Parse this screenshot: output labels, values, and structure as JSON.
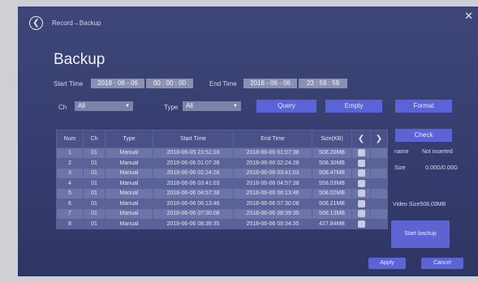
{
  "breadcrumb": "Record→Backup",
  "title": "Backup",
  "start_time": {
    "label": "Start Time",
    "date": "2018 - 06 - 06",
    "time": "00 : 00 : 00"
  },
  "end_time": {
    "label": "End Time",
    "date": "2018 - 06 - 06",
    "time": "23 : 59 : 59"
  },
  "ch": {
    "label": "Ch",
    "value": "All"
  },
  "type": {
    "label": "Type",
    "value": "All"
  },
  "buttons": {
    "query": "Query",
    "empty": "Empty",
    "format": "Format",
    "check": "Check",
    "start_backup": "Start backup",
    "apply": "Apply",
    "cancel": "Cancel"
  },
  "table": {
    "headers": [
      "Num",
      "Ch",
      "Type",
      "Start Time",
      "End Time",
      "Size(KB)"
    ],
    "rows": [
      [
        "1",
        "01",
        "Manual",
        "2018-06-05 23:51:03",
        "2018-06-06 01:07:38",
        "508.20MB"
      ],
      [
        "2",
        "01",
        "Manual",
        "2018-06-06 01:07:38",
        "2018-06-06 02:24:28",
        "508.30MB"
      ],
      [
        "3",
        "01",
        "Manual",
        "2018-06-06 02:24:28",
        "2018-06-06 03:41:03",
        "508.47MB"
      ],
      [
        "4",
        "01",
        "Manual",
        "2018-06-06 03:41:03",
        "2018-06-06 04:57:38",
        "558.03MB"
      ],
      [
        "5",
        "01",
        "Manual",
        "2018-06-06 04:57:38",
        "2018-06-06 06:13:46",
        "508.02MB"
      ],
      [
        "6",
        "01",
        "Manual",
        "2018-06-06 06:13:46",
        "2018-06-06 07:30:08",
        "508.21MB"
      ],
      [
        "7",
        "01",
        "Manual",
        "2018-06-06 07:30:08",
        "2018-06-06 08:39:35",
        "508.13MB"
      ],
      [
        "8",
        "01",
        "Manual",
        "2018-06-06 08:39:35",
        "2018-06-06 09:34:35",
        "427.84MB"
      ]
    ]
  },
  "device": {
    "name_label": "name",
    "name_value": "Not inserted",
    "size_label": "Size",
    "size_value": "0.00G/0.00G"
  },
  "video_size": "Video Size508.03MB",
  "colors": {
    "accent": "#5c63d6",
    "panel": "#3b4275"
  },
  "icons": {
    "back": "back-circle-icon",
    "close": "close-icon",
    "prev": "chevron-left-icon",
    "next": "chevron-right-icon"
  }
}
